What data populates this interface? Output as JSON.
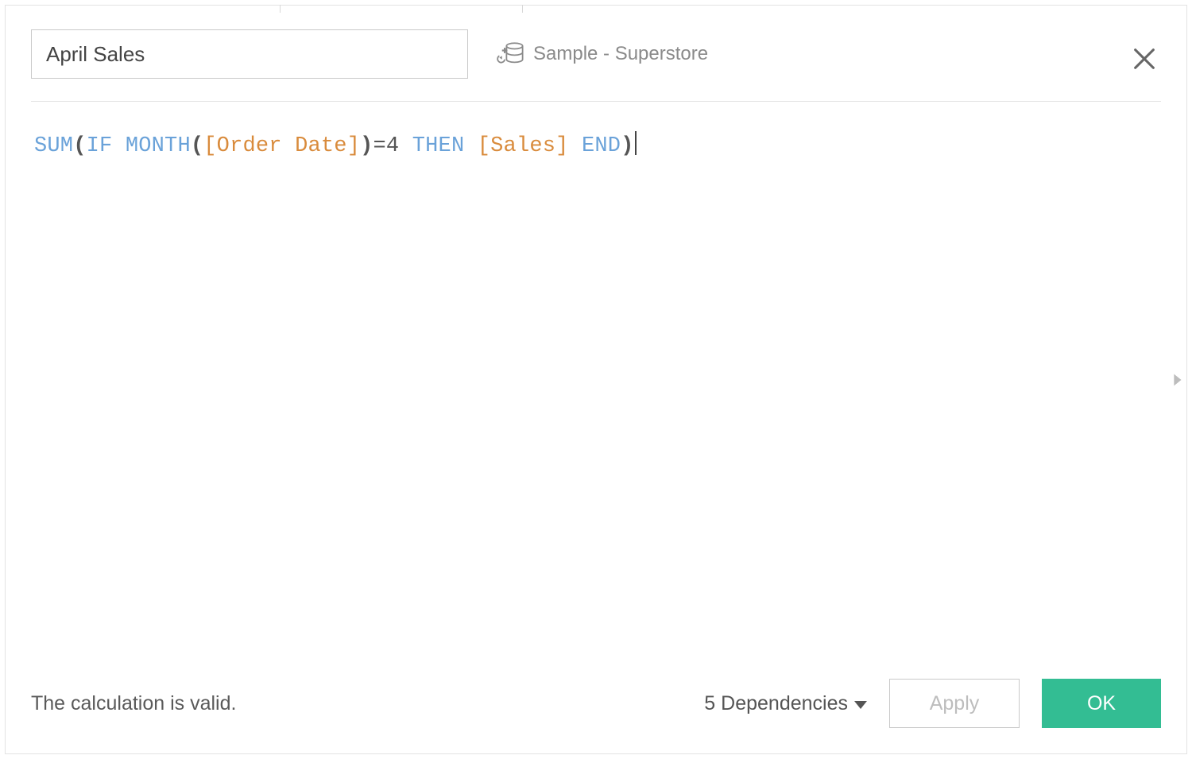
{
  "dialog": {
    "field_name": "April Sales",
    "datasource": "Sample - Superstore"
  },
  "formula": {
    "tokens": [
      {
        "kind": "func",
        "text": "SUM"
      },
      {
        "kind": "punct",
        "text": "("
      },
      {
        "kind": "kw",
        "text": "IF "
      },
      {
        "kind": "func",
        "text": "MONTH"
      },
      {
        "kind": "punct",
        "text": "("
      },
      {
        "kind": "field",
        "text": "[Order Date]"
      },
      {
        "kind": "punct",
        "text": ")"
      },
      {
        "kind": "plain",
        "text": "=4 "
      },
      {
        "kind": "kw",
        "text": "THEN "
      },
      {
        "kind": "field",
        "text": "[Sales]"
      },
      {
        "kind": "plain",
        "text": " "
      },
      {
        "kind": "kw",
        "text": "END"
      },
      {
        "kind": "punct",
        "text": ")"
      }
    ]
  },
  "footer": {
    "status": "The calculation is valid.",
    "dependencies_label": "5 Dependencies",
    "apply_label": "Apply",
    "ok_label": "OK"
  }
}
